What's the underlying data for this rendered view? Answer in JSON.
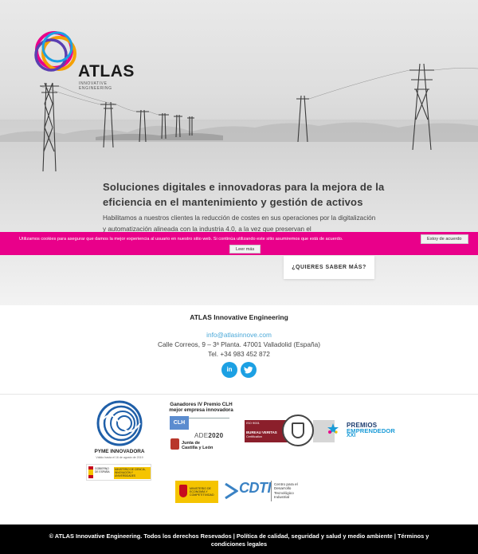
{
  "brand": {
    "name": "ATLAS",
    "tagline_line1": "INNOVATIVE",
    "tagline_line2": "ENGINEERING"
  },
  "hero": {
    "title": "Soluciones digitales e innovadoras para la mejora de la eficiencia en el mantenimiento y gestión de activos",
    "text": "Habilitamos a nuestros clientes la reducción de costes en sus operaciones por la digitalización y automatización alineada con la industria 4.0, a la vez que preservan el",
    "cta_label": "¿QUIERES SABER MÁS?"
  },
  "cookie_bar": {
    "message": "Utilizamos cookies para asegurar que damos la mejor experiencia al usuario en nuestro sitio web. Si continúa utilizando este sitio asumiremos que está de acuerdo.",
    "accept_label": "Estoy de acuerdo",
    "more_label": "Leer más",
    "color": "#e9008a"
  },
  "contact": {
    "company": "ATLAS Innovative Engineering",
    "email": "info@atlasinnove.com",
    "address": "Calle Correos, 9 – 3ª Planta. 47001 Valladolid (España)",
    "phone": "Tel. +34 983 452 872",
    "social": [
      {
        "name": "linkedin-icon",
        "glyph": "in"
      },
      {
        "name": "twitter-icon",
        "glyph": "t"
      }
    ],
    "accent": "#1ca0e3"
  },
  "logos": {
    "pyme": {
      "label": "PYME INNOVADORA",
      "sub": "Válido hasta el 16 de agosto de 2019"
    },
    "gobierno": {
      "left": "GOBIERNO DE ESPAÑA",
      "right": "MINISTERIO DE CIENCIA, INNOVACIÓN Y UNIVERSIDADES"
    },
    "clh": {
      "title": "Ganadores IV Premio CLH mejor empresa innovadora",
      "badge": "CLH",
      "ade": "ADE",
      "ade_year": "2020",
      "jcyl": "Junta de Castilla y León"
    },
    "bureau_veritas": {
      "iso": "ISO 9001",
      "name": "BUREAU VERITAS",
      "cert": "Certification"
    },
    "premios": {
      "line1": "PREMIOS",
      "line2": "EMPRENDEDOR",
      "line3": "XXI"
    },
    "ministerio": {
      "text": "MINISTERIO DE ECONOMÍA Y COMPETITIVIDAD"
    },
    "cdti": {
      "word": "CDTI",
      "text": "Centro para el Desarrollo Tecnológico Industrial"
    }
  },
  "footer": {
    "text": "© ATLAS Innovative Engineering. Todos los derechos Resevados | Política de calidad, seguridad y salud y medio ambiente | Términos y condiciones legales"
  }
}
